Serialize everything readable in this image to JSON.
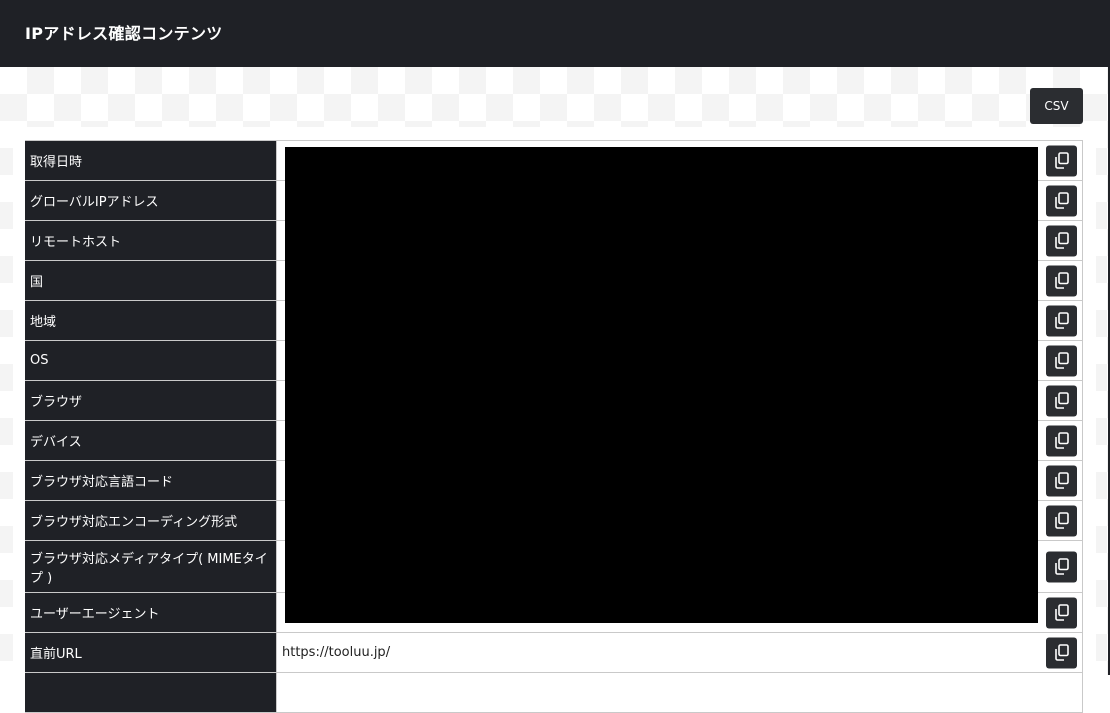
{
  "header": {
    "title": "IPアドレス確認コンテンツ"
  },
  "toolbar": {
    "csv_label": "CSV"
  },
  "rows": [
    {
      "label": "取得日時",
      "value": ""
    },
    {
      "label": "グローバルIPアドレス",
      "value": ""
    },
    {
      "label": "リモートホスト",
      "value": ""
    },
    {
      "label": "国",
      "value": ""
    },
    {
      "label": "地域",
      "value": ""
    },
    {
      "label": "OS",
      "value": ""
    },
    {
      "label": "ブラウザ",
      "value": ""
    },
    {
      "label": "デバイス",
      "value": ""
    },
    {
      "label": "ブラウザ対応言語コード",
      "value": ""
    },
    {
      "label": "ブラウザ対応エンコーディング形式",
      "value": ""
    },
    {
      "label": "ブラウザ対応メディアタイプ( MIMEタイプ )",
      "value": ""
    },
    {
      "label": "ユーザーエージェント",
      "value": ""
    },
    {
      "label": "直前URL",
      "value": "https://tooluu.jp/"
    },
    {
      "label": "",
      "value": ""
    }
  ],
  "icons": {
    "copy": "copy-icon"
  },
  "colors": {
    "header_bg": "#1f2126",
    "button_bg": "#2b2d31",
    "label_bg": "#1f2126"
  }
}
